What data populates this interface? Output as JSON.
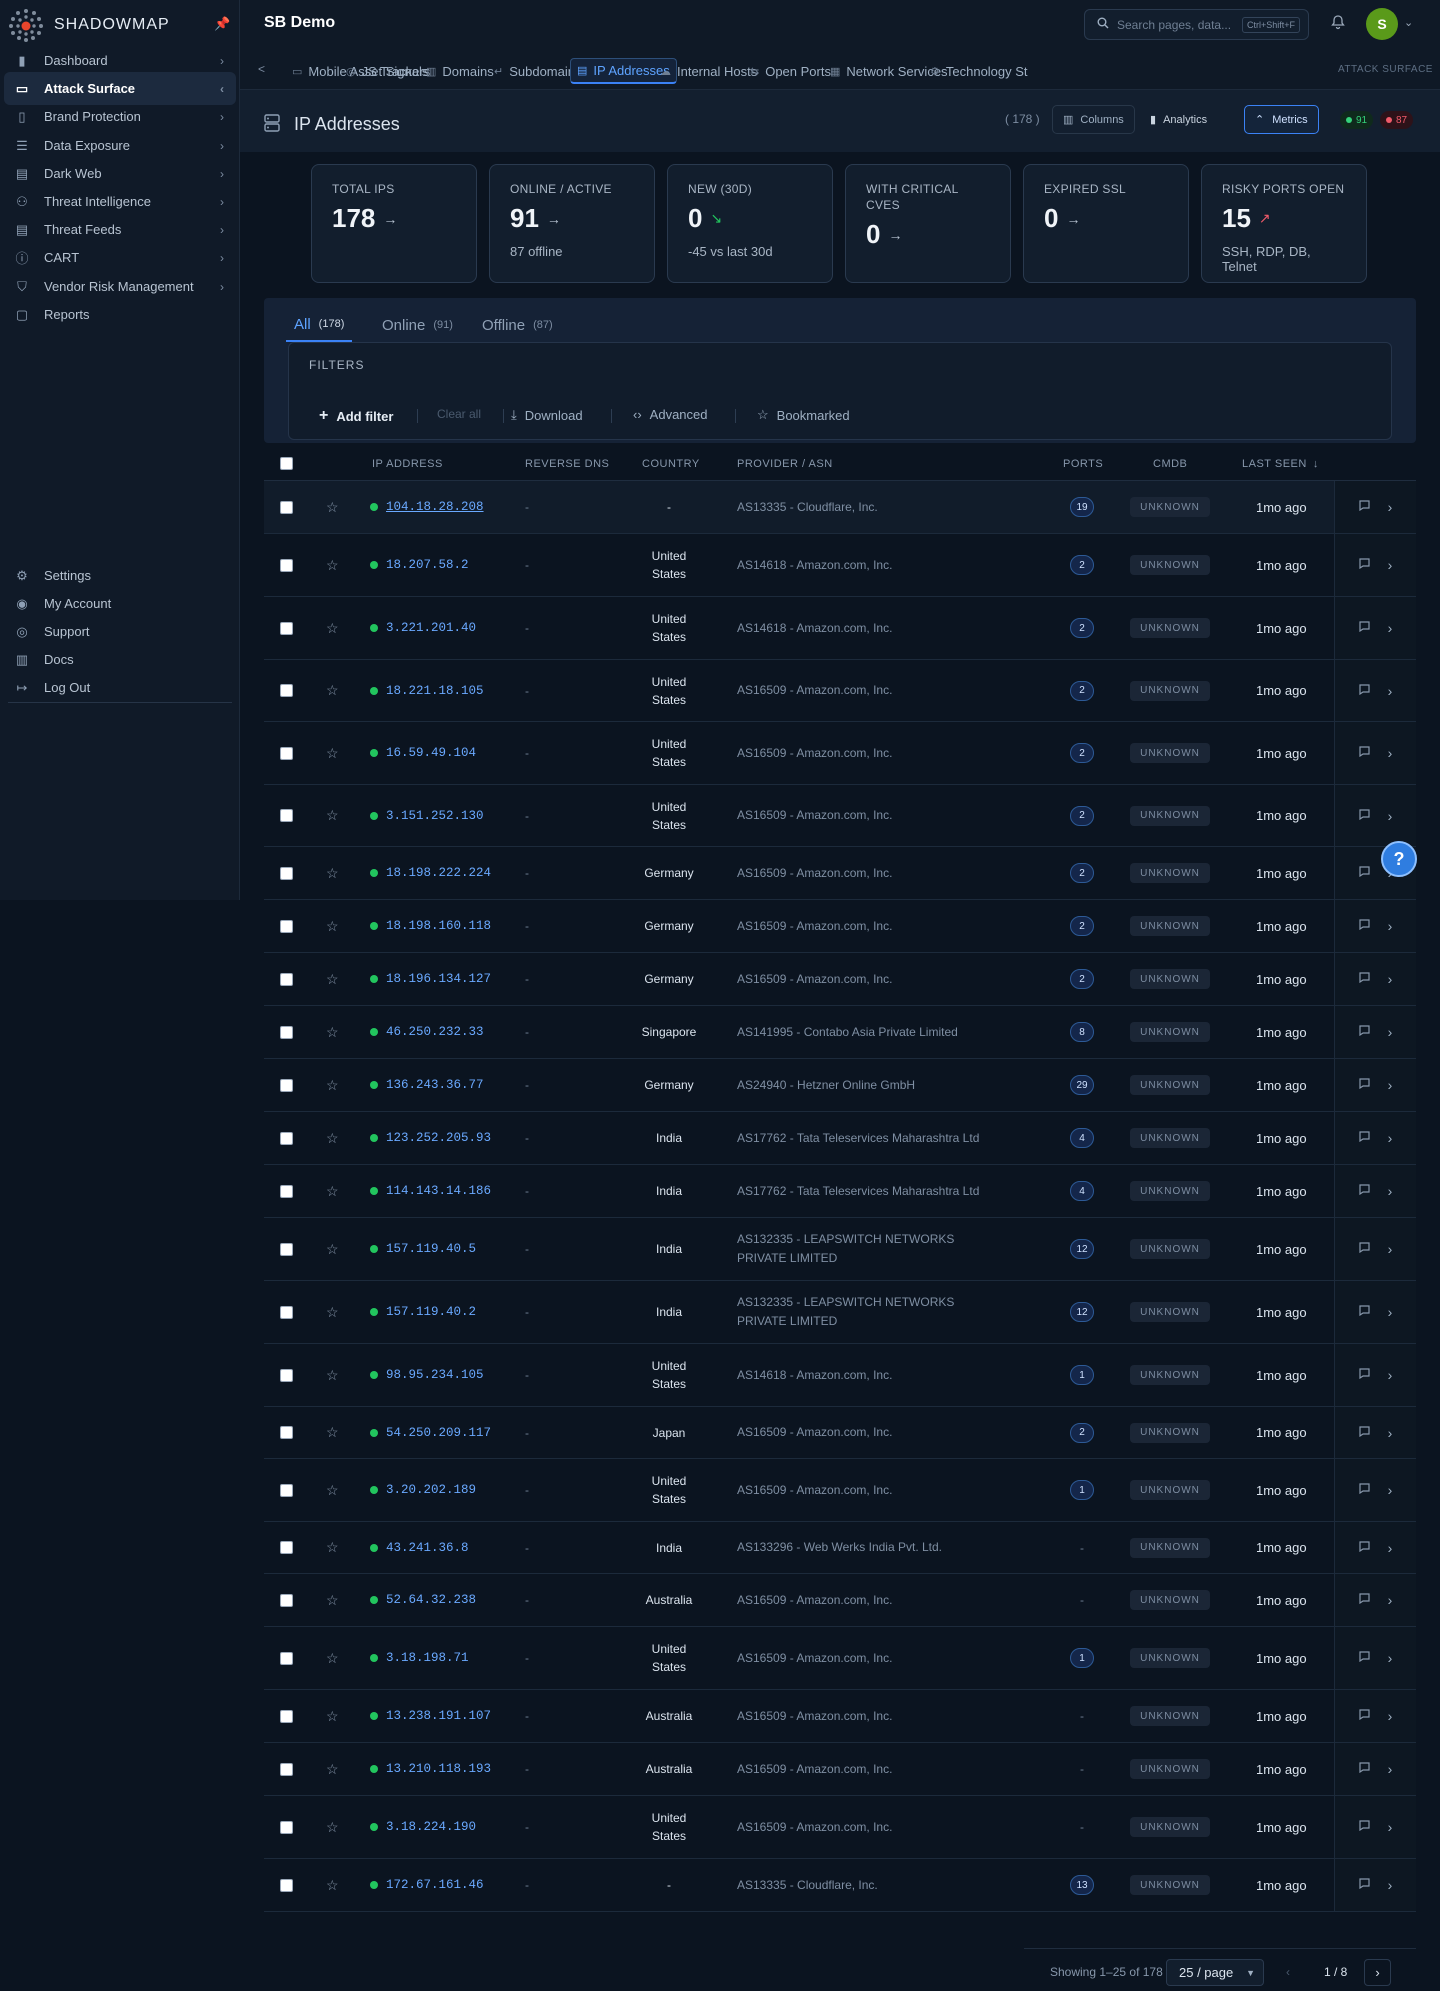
{
  "brand": {
    "name": "SHADOWMAP"
  },
  "app": {
    "title": "SB Demo"
  },
  "search": {
    "placeholder": "Search pages, data...",
    "shortcut": "Ctrl+Shift+F"
  },
  "user": {
    "initial": "S"
  },
  "sidebar": {
    "items": [
      {
        "label": "Dashboard",
        "icon": "bar-chart-icon",
        "chevron": "›"
      },
      {
        "label": "Attack Surface",
        "icon": "laptop-icon",
        "chevron": "‹"
      },
      {
        "label": "Brand Protection",
        "icon": "building-icon",
        "chevron": "›"
      },
      {
        "label": "Data Exposure",
        "icon": "stack-icon",
        "chevron": "›"
      },
      {
        "label": "Dark Web",
        "icon": "browser-icon",
        "chevron": "›"
      },
      {
        "label": "Threat Intelligence",
        "icon": "users-icon",
        "chevron": "›"
      },
      {
        "label": "Threat Feeds",
        "icon": "document-icon",
        "chevron": "›"
      },
      {
        "label": "CART",
        "icon": "info-circle-icon",
        "chevron": "›"
      },
      {
        "label": "Vendor Risk Management",
        "icon": "shield-check-icon",
        "chevron": "›"
      },
      {
        "label": "Reports",
        "icon": "report-icon",
        "chevron": ""
      }
    ],
    "bottom": [
      {
        "label": "Settings",
        "icon": "gear-icon"
      },
      {
        "label": "My Account",
        "icon": "user-circle-icon"
      },
      {
        "label": "Support",
        "icon": "support-icon"
      },
      {
        "label": "Docs",
        "icon": "book-icon"
      },
      {
        "label": "Log Out",
        "icon": "logout-icon"
      }
    ]
  },
  "tabs": {
    "back": "<",
    "items": [
      {
        "label": "Mobile Asset Signals",
        "icon": "folder-icon"
      },
      {
        "label": "JS Trackers",
        "icon": "target-icon"
      },
      {
        "label": "Domains",
        "icon": "globe-icon"
      },
      {
        "label": "Subdomains",
        "icon": "return-icon"
      },
      {
        "label": "IP Addresses",
        "icon": "server-icon"
      },
      {
        "label": "Internal Hosts",
        "icon": "cloud-icon"
      },
      {
        "label": "Open Ports",
        "icon": "port-icon"
      },
      {
        "label": "Network Services",
        "icon": "network-icon"
      },
      {
        "label": "Technology St",
        "icon": "gear-icon"
      }
    ],
    "section": "ATTACK SURFACE"
  },
  "page": {
    "title": "IP Addresses",
    "count": "( 178 )",
    "columns_label": "Columns",
    "analytics_label": "Analytics",
    "metrics_label": "Metrics",
    "online_pill": "91",
    "offline_pill": "87"
  },
  "metrics": [
    {
      "title": "TOTAL IPS",
      "value": "178",
      "trend": "→",
      "sub": ""
    },
    {
      "title": "ONLINE / ACTIVE",
      "value": "91",
      "trend": "→",
      "sub": "87 offline"
    },
    {
      "title": "NEW (30D)",
      "value": "0",
      "trend": "↘",
      "sub": "-45 vs last 30d"
    },
    {
      "title": "WITH CRITICAL CVES",
      "value": "0",
      "trend": "→",
      "sub": ""
    },
    {
      "title": "EXPIRED SSL",
      "value": "0",
      "trend": "→",
      "sub": ""
    },
    {
      "title": "RISKY PORTS OPEN",
      "value": "15",
      "trend": "↗",
      "sub": "SSH, RDP, DB, Telnet"
    }
  ],
  "subtabs": [
    {
      "label": "All",
      "count": "(178)"
    },
    {
      "label": "Online",
      "count": "(91)"
    },
    {
      "label": "Offline",
      "count": "(87)"
    }
  ],
  "filters": {
    "label": "FILTERS",
    "add": "Add filter",
    "clear": "Clear all",
    "download": "Download",
    "advanced": "Advanced",
    "bookmarked": "Bookmarked"
  },
  "table": {
    "headers": {
      "ip": "IP ADDRESS",
      "dns": "REVERSE DNS",
      "country": "COUNTRY",
      "asn": "PROVIDER / ASN",
      "ports": "PORTS",
      "cmdb": "CMDB",
      "seen": "LAST SEEN"
    },
    "sort_icon": "↓",
    "rows": [
      {
        "ip": "104.18.28.208",
        "dns": "-",
        "country": "-",
        "asn": "AS13335 - Cloudflare, Inc.",
        "ports": "19",
        "cmdb": "UNKNOWN",
        "seen": "1mo ago"
      },
      {
        "ip": "18.207.58.2",
        "dns": "-",
        "country": "United States",
        "asn": "AS14618 - Amazon.com, Inc.",
        "ports": "2",
        "cmdb": "UNKNOWN",
        "seen": "1mo ago"
      },
      {
        "ip": "3.221.201.40",
        "dns": "-",
        "country": "United States",
        "asn": "AS14618 - Amazon.com, Inc.",
        "ports": "2",
        "cmdb": "UNKNOWN",
        "seen": "1mo ago"
      },
      {
        "ip": "18.221.18.105",
        "dns": "-",
        "country": "United States",
        "asn": "AS16509 - Amazon.com, Inc.",
        "ports": "2",
        "cmdb": "UNKNOWN",
        "seen": "1mo ago"
      },
      {
        "ip": "16.59.49.104",
        "dns": "-",
        "country": "United States",
        "asn": "AS16509 - Amazon.com, Inc.",
        "ports": "2",
        "cmdb": "UNKNOWN",
        "seen": "1mo ago"
      },
      {
        "ip": "3.151.252.130",
        "dns": "-",
        "country": "United States",
        "asn": "AS16509 - Amazon.com, Inc.",
        "ports": "2",
        "cmdb": "UNKNOWN",
        "seen": "1mo ago"
      },
      {
        "ip": "18.198.222.224",
        "dns": "-",
        "country": "Germany",
        "asn": "AS16509 - Amazon.com, Inc.",
        "ports": "2",
        "cmdb": "UNKNOWN",
        "seen": "1mo ago"
      },
      {
        "ip": "18.198.160.118",
        "dns": "-",
        "country": "Germany",
        "asn": "AS16509 - Amazon.com, Inc.",
        "ports": "2",
        "cmdb": "UNKNOWN",
        "seen": "1mo ago"
      },
      {
        "ip": "18.196.134.127",
        "dns": "-",
        "country": "Germany",
        "asn": "AS16509 - Amazon.com, Inc.",
        "ports": "2",
        "cmdb": "UNKNOWN",
        "seen": "1mo ago"
      },
      {
        "ip": "46.250.232.33",
        "dns": "-",
        "country": "Singapore",
        "asn": "AS141995 - Contabo Asia Private Limited",
        "ports": "8",
        "cmdb": "UNKNOWN",
        "seen": "1mo ago"
      },
      {
        "ip": "136.243.36.77",
        "dns": "-",
        "country": "Germany",
        "asn": "AS24940 - Hetzner Online GmbH",
        "ports": "29",
        "cmdb": "UNKNOWN",
        "seen": "1mo ago"
      },
      {
        "ip": "123.252.205.93",
        "dns": "-",
        "country": "India",
        "asn": "AS17762 - Tata Teleservices Maharashtra Ltd",
        "ports": "4",
        "cmdb": "UNKNOWN",
        "seen": "1mo ago"
      },
      {
        "ip": "114.143.14.186",
        "dns": "-",
        "country": "India",
        "asn": "AS17762 - Tata Teleservices Maharashtra Ltd",
        "ports": "4",
        "cmdb": "UNKNOWN",
        "seen": "1mo ago"
      },
      {
        "ip": "157.119.40.5",
        "dns": "-",
        "country": "India",
        "asn": "AS132335 - LEAPSWITCH NETWORKS PRIVATE LIMITED",
        "ports": "12",
        "cmdb": "UNKNOWN",
        "seen": "1mo ago"
      },
      {
        "ip": "157.119.40.2",
        "dns": "-",
        "country": "India",
        "asn": "AS132335 - LEAPSWITCH NETWORKS PRIVATE LIMITED",
        "ports": "12",
        "cmdb": "UNKNOWN",
        "seen": "1mo ago"
      },
      {
        "ip": "98.95.234.105",
        "dns": "-",
        "country": "United States",
        "asn": "AS14618 - Amazon.com, Inc.",
        "ports": "1",
        "cmdb": "UNKNOWN",
        "seen": "1mo ago"
      },
      {
        "ip": "54.250.209.117",
        "dns": "-",
        "country": "Japan",
        "asn": "AS16509 - Amazon.com, Inc.",
        "ports": "2",
        "cmdb": "UNKNOWN",
        "seen": "1mo ago"
      },
      {
        "ip": "3.20.202.189",
        "dns": "-",
        "country": "United States",
        "asn": "AS16509 - Amazon.com, Inc.",
        "ports": "1",
        "cmdb": "UNKNOWN",
        "seen": "1mo ago"
      },
      {
        "ip": "43.241.36.8",
        "dns": "-",
        "country": "India",
        "asn": "AS133296 - Web Werks India Pvt. Ltd.",
        "ports": "-",
        "cmdb": "UNKNOWN",
        "seen": "1mo ago"
      },
      {
        "ip": "52.64.32.238",
        "dns": "-",
        "country": "Australia",
        "asn": "AS16509 - Amazon.com, Inc.",
        "ports": "-",
        "cmdb": "UNKNOWN",
        "seen": "1mo ago"
      },
      {
        "ip": "3.18.198.71",
        "dns": "-",
        "country": "United States",
        "asn": "AS16509 - Amazon.com, Inc.",
        "ports": "1",
        "cmdb": "UNKNOWN",
        "seen": "1mo ago"
      },
      {
        "ip": "13.238.191.107",
        "dns": "-",
        "country": "Australia",
        "asn": "AS16509 - Amazon.com, Inc.",
        "ports": "-",
        "cmdb": "UNKNOWN",
        "seen": "1mo ago"
      },
      {
        "ip": "13.210.118.193",
        "dns": "-",
        "country": "Australia",
        "asn": "AS16509 - Amazon.com, Inc.",
        "ports": "-",
        "cmdb": "UNKNOWN",
        "seen": "1mo ago"
      },
      {
        "ip": "3.18.224.190",
        "dns": "-",
        "country": "United States",
        "asn": "AS16509 - Amazon.com, Inc.",
        "ports": "-",
        "cmdb": "UNKNOWN",
        "seen": "1mo ago"
      },
      {
        "ip": "172.67.161.46",
        "dns": "-",
        "country": "-",
        "asn": "AS13335 - Cloudflare, Inc.",
        "ports": "13",
        "cmdb": "UNKNOWN",
        "seen": "1mo ago"
      }
    ]
  },
  "pager": {
    "showing": "Showing 1–25 of 178",
    "per_page": "25 / page",
    "page": "1 / 8",
    "prev": "‹",
    "next": "›"
  },
  "help": {
    "label": "?"
  },
  "colors": {
    "accent": "#3b82f6",
    "online": "#22c55e",
    "offline": "#f05a6a",
    "background": "#0b1420"
  }
}
